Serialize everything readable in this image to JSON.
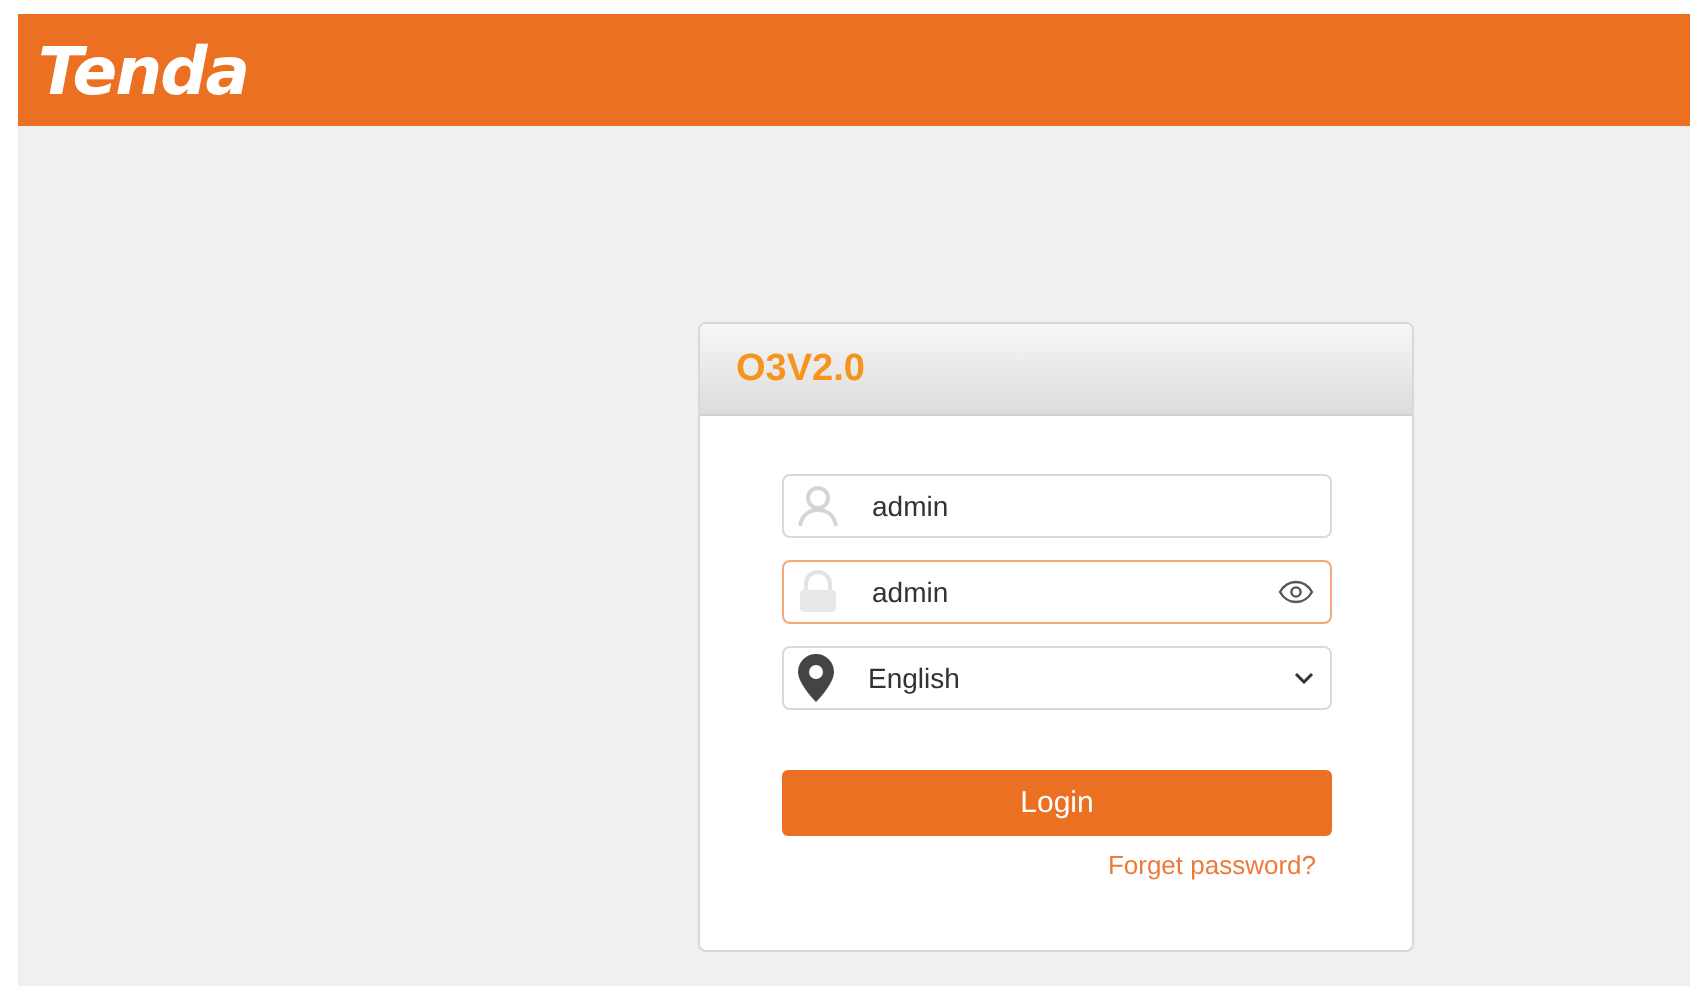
{
  "header": {
    "logo": "Tenda"
  },
  "login": {
    "title": "O3V2.0",
    "fields": [
      {
        "kind": "user",
        "value": "admin",
        "focused": false
      },
      {
        "kind": "password",
        "value": "admin",
        "focused": true
      },
      {
        "kind": "language",
        "value": "English",
        "focused": false
      }
    ],
    "button": "Login",
    "link": "Forget password?"
  }
}
